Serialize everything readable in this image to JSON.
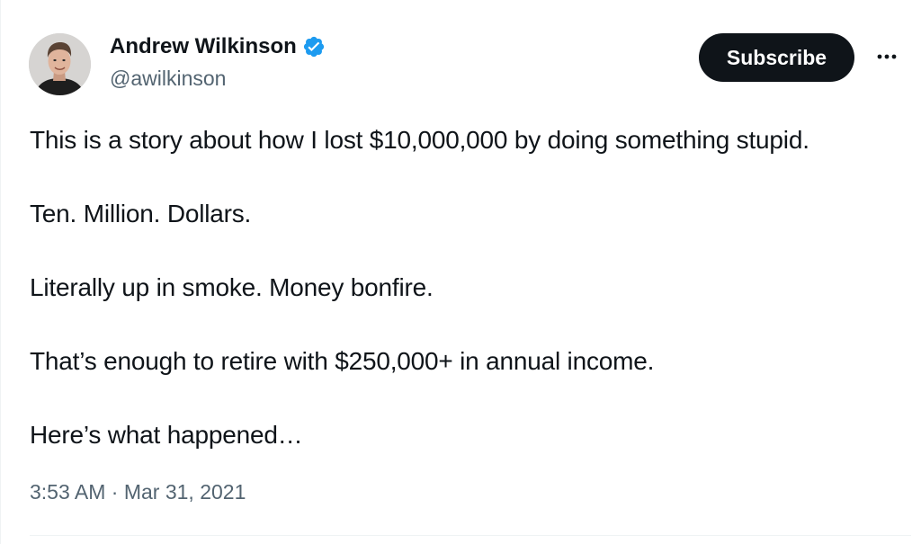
{
  "author": {
    "display_name": "Andrew Wilkinson",
    "handle": "@awilkinson",
    "verified": true,
    "avatar_icon": "profile-photo",
    "verified_icon": "verified-badge-icon",
    "verified_color": "#1d9bf0"
  },
  "actions": {
    "subscribe_label": "Subscribe",
    "more_icon": "more-options-icon"
  },
  "tweet": {
    "lines": [
      "This is a story about how I lost $10,000,000 by doing something stupid.",
      "Ten. Million. Dollars.",
      "Literally up in smoke. Money bonfire.",
      "That’s enough to retire with $250,000+ in annual income.",
      "Here’s what happened…"
    ],
    "time": "3:53 AM",
    "separator": "·",
    "date": "Mar 31, 2021"
  },
  "colors": {
    "text": "#0f1419",
    "secondary": "#536471",
    "button_bg": "#0f1419",
    "button_text": "#ffffff",
    "divider": "#eff3f4"
  }
}
